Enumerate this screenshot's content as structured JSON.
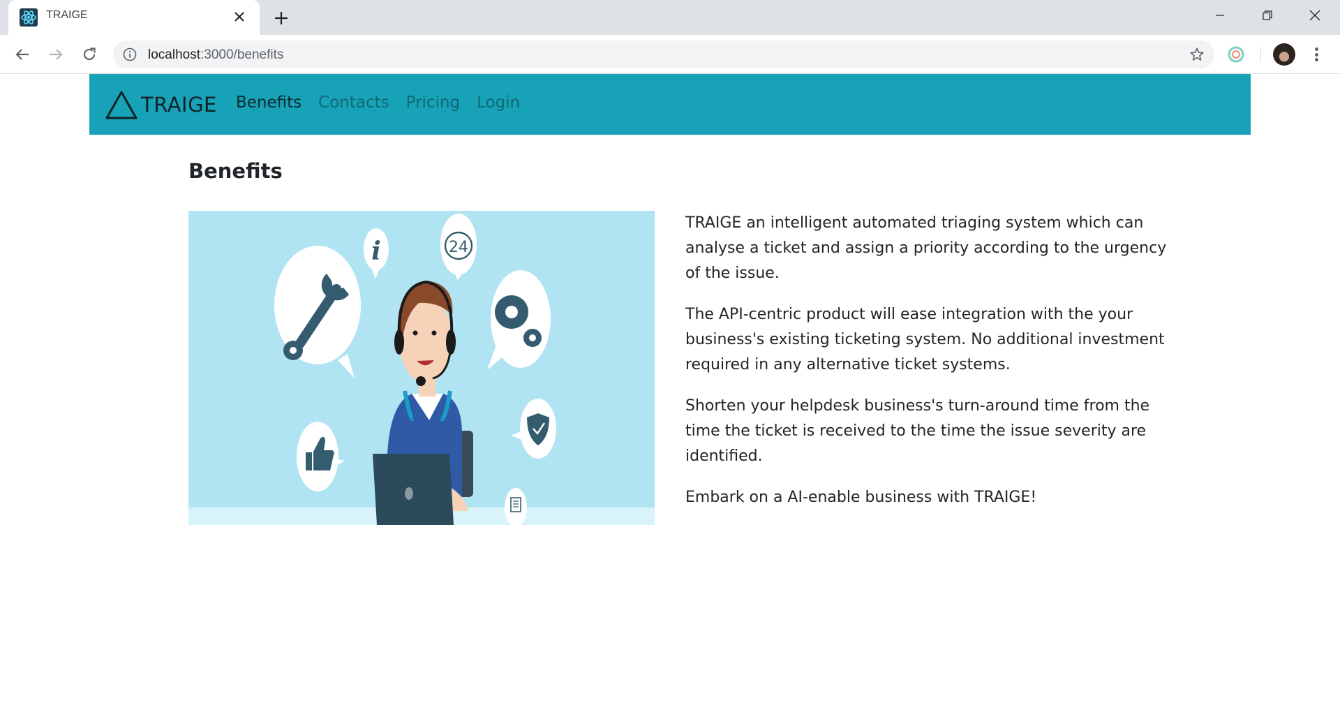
{
  "browser": {
    "tab_title": "TRAIGE",
    "url_host": "localhost",
    "url_rest": ":3000/benefits",
    "icons": {
      "favicon": "react-atom-icon",
      "close": "close-icon",
      "new_tab": "plus-icon",
      "back": "arrow-left-icon",
      "forward": "arrow-right-icon",
      "reload": "reload-icon",
      "info": "info-icon",
      "bookmark": "star-icon",
      "extension": "extension-ring-icon",
      "menu": "kebab-menu-icon"
    }
  },
  "navbar": {
    "brand": "TRAIGE",
    "background": "#17a2b8",
    "links": [
      {
        "label": "Benefits",
        "active": true
      },
      {
        "label": "Contacts",
        "active": false
      },
      {
        "label": "Pricing",
        "active": false
      },
      {
        "label": "Login",
        "active": false
      }
    ]
  },
  "page": {
    "title": "Benefits",
    "hero_image": "helpdesk-agent-illustration",
    "paragraphs": [
      "TRAIGE an intelligent automated triaging system which can analyse a ticket and assign a priority according to the urgency of the issue.",
      "The API-centric product will ease integration with the your business's existing ticketing system. No additional investment required in any alternative ticket systems.",
      "Shorten your helpdesk business's turn-around time from the time the ticket is received to the time the issue severity are identified.",
      "Embark on a AI-enable business with TRAIGE!"
    ]
  }
}
